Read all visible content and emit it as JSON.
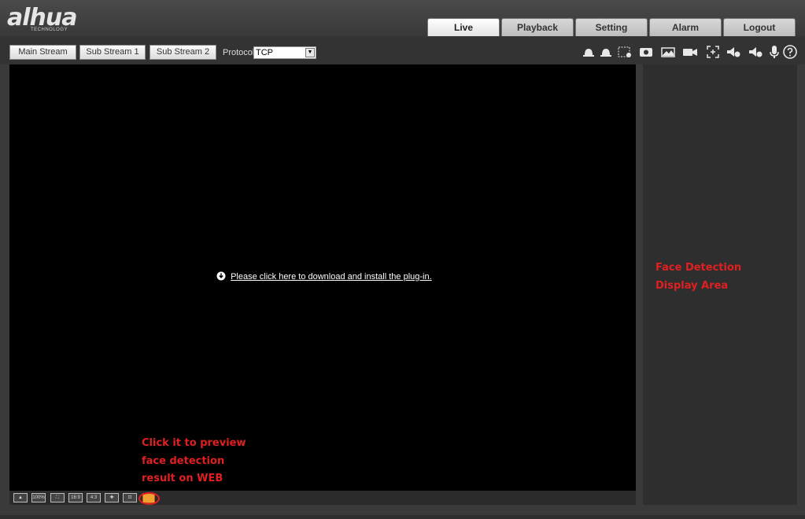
{
  "header": {
    "logo_text": "alhua",
    "logo_sub": "TECHNOLOGY",
    "tabs": [
      {
        "label": "Live",
        "active": true
      },
      {
        "label": "Playback",
        "active": false
      },
      {
        "label": "Setting",
        "active": false
      },
      {
        "label": "Alarm",
        "active": false
      },
      {
        "label": "Logout",
        "active": false
      }
    ]
  },
  "toolbar": {
    "streams": [
      "Main Stream",
      "Sub Stream 1",
      "Sub Stream 2"
    ],
    "protocol_label": "Protocol",
    "protocol_value": "TCP",
    "icons": [
      "alarm-out-1-icon",
      "alarm-out-2-icon",
      "region-focus-icon",
      "snapshot-icon",
      "image-adjust-icon",
      "record-icon",
      "zoom-icon",
      "audio-out-icon",
      "audio-in-icon",
      "microphone-icon",
      "help-icon"
    ]
  },
  "video": {
    "plugin_link": "Please click here to download and install the plug-in."
  },
  "annotations": {
    "preview_line1": "Click it to preview",
    "preview_line2": "face detection",
    "preview_line3": "result on WEB",
    "panel_line1": "Face Detection",
    "panel_line2": "Display Area"
  },
  "bottom_bar": {
    "icons": [
      "fullscreen-icon",
      "zoom-100-icon",
      "fit-icon",
      "ratio-16-9-icon",
      "ratio-4-3-icon",
      "ptz-icon",
      "local-zoom-icon",
      "face-detection-icon"
    ],
    "labels": [
      "",
      "100%",
      "",
      "16:9",
      "4:3",
      "",
      "",
      ""
    ]
  },
  "colors": {
    "annotation": "#e02020",
    "highlight": "#f2a030"
  }
}
